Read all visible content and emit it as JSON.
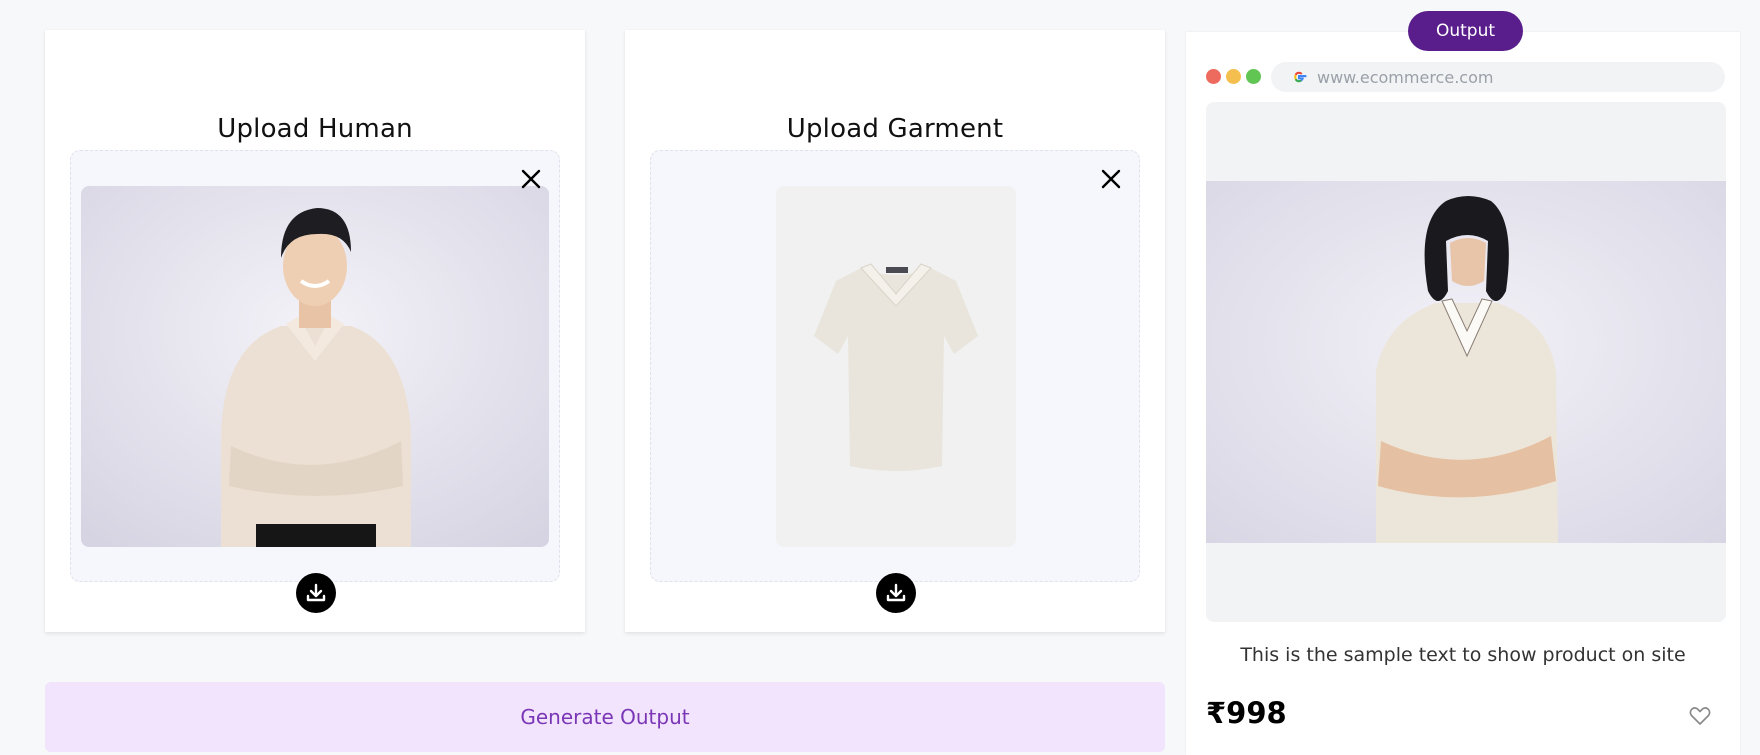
{
  "upload_human": {
    "title": "Upload Human",
    "close_icon": "close-icon",
    "download_icon": "download-icon"
  },
  "upload_garment": {
    "title": "Upload Garment",
    "close_icon": "close-icon",
    "download_icon": "download-icon"
  },
  "generate": {
    "label": "Generate Output"
  },
  "output": {
    "badge": "Output",
    "browser": {
      "url": "www.ecommerce.com",
      "search_icon": "google-icon",
      "dot_colors": [
        "#ed6a5e",
        "#f5bf4f",
        "#61c554"
      ]
    },
    "caption": "This is the sample text to show product on site",
    "price": "₹998",
    "favorite_icon": "heart-icon"
  },
  "colors": {
    "accent": "#5a1e8c",
    "generate_bg": "#f1e4fc",
    "generate_text": "#7a36b6"
  }
}
